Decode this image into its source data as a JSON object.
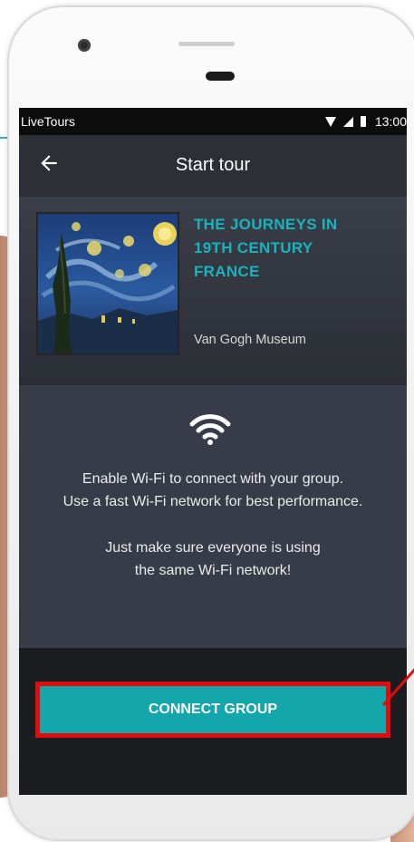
{
  "status_bar": {
    "app_name": "LiveTours",
    "time": "13:00",
    "icons": [
      "wifi-icon",
      "signal-icon",
      "battery-icon"
    ]
  },
  "header": {
    "title": "Start tour",
    "back_icon": "back-arrow-icon"
  },
  "tour": {
    "title_line1": "THE JOURNEYS IN",
    "title_line2": "19TH CENTURY",
    "title_line3": "FRANCE",
    "museum": "Van Gogh Museum",
    "artwork": "starry-night-thumbnail"
  },
  "info": {
    "icon": "wifi-icon",
    "line1": "Enable Wi-Fi to connect with your group.",
    "line2": "Use a fast Wi-Fi network for best performance.",
    "line3": "Just make sure everyone is using",
    "line4": "the same Wi-Fi network!"
  },
  "action": {
    "connect_label": "CONNECT GROUP"
  },
  "colors": {
    "accent": "#13a7ac",
    "title_teal": "#19b3bd",
    "highlight_red": "#e10d0d",
    "panel": "#383c48",
    "app_bar": "#2c2f36"
  }
}
